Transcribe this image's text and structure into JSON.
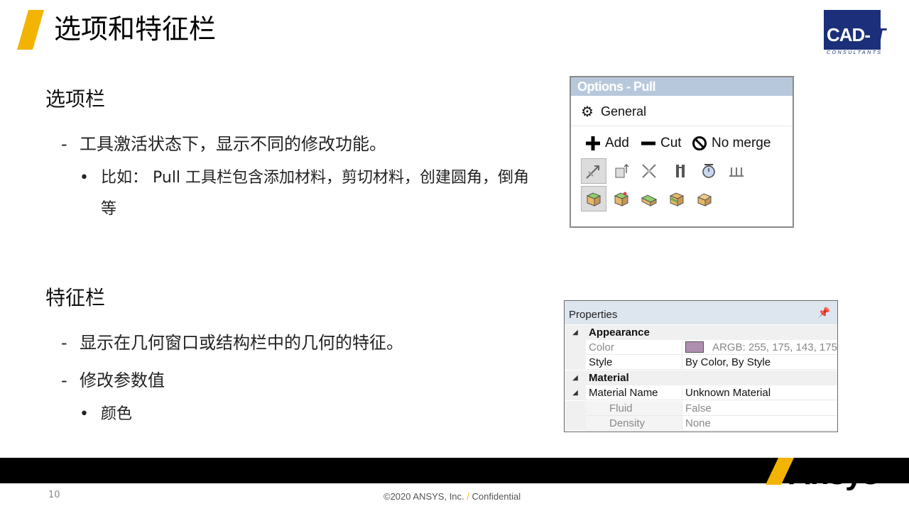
{
  "title": "选项和特征栏",
  "logo": {
    "main": "CAD-",
    "it": "IT",
    "sub": "CONSULTANTS"
  },
  "section1": {
    "heading": "选项栏",
    "dash_mark": "-",
    "dash1": "工具激活状态下，显示不同的修改功能。",
    "bullet_mark": "•",
    "bullet1": "比如： Pull 工具栏包含添加材料，剪切材料，创建圆角，倒角等"
  },
  "section2": {
    "heading": "特征栏",
    "dash_mark": "-",
    "dash1": "显示在几何窗口或结构栏中的几何的特征。",
    "dash2": "修改参数值",
    "bullet_mark": "•",
    "bullet1": "颜色"
  },
  "options_panel": {
    "title": "Options - Pull",
    "general": "General",
    "modes": [
      "Add",
      "Cut",
      "No merge"
    ]
  },
  "properties_panel": {
    "title": "Properties",
    "rows": [
      {
        "kind": "category",
        "name": "Appearance"
      },
      {
        "kind": "prop",
        "name": "Color",
        "value": "ARGB: 255, 175, 143, 175",
        "swatch": "#af8faf",
        "readonly": true
      },
      {
        "kind": "prop",
        "name": "Style",
        "value": "By Color, By Style"
      },
      {
        "kind": "category",
        "name": "Material"
      },
      {
        "kind": "prop",
        "name": "Material Name",
        "value": "Unknown Material",
        "expander": true
      },
      {
        "kind": "sub",
        "name": "Fluid",
        "value": "False"
      },
      {
        "kind": "sub",
        "name": "Density",
        "value": "None"
      }
    ]
  },
  "colors": {
    "accent_yellow": "#f2b400",
    "logo_blue": "#1b2f7a"
  },
  "footer": {
    "page_number": "10",
    "copyright_pre": "©2020 ANSYS, Inc. ",
    "copyright_slash": "/",
    "copyright_post": " Confidential",
    "brand": "Ansys"
  }
}
